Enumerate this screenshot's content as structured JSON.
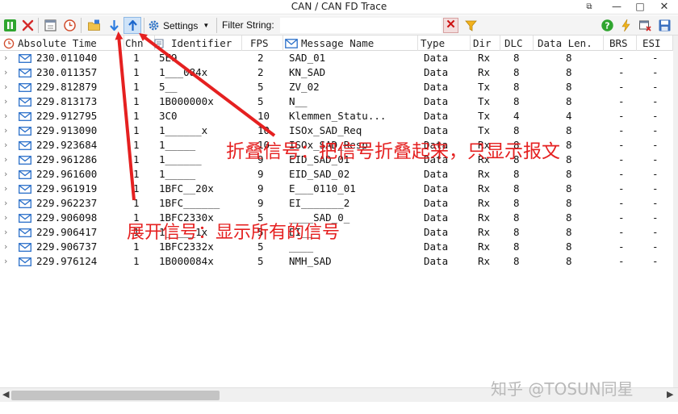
{
  "window": {
    "title": "CAN / CAN FD Trace",
    "controls": {
      "restore": "⧉",
      "minimize": "—",
      "maximize": "□",
      "close": "✕"
    }
  },
  "toolbar": {
    "settings_label": "Settings",
    "filter_label": "Filter String:",
    "filter_value": "",
    "filter_clear": "✕"
  },
  "columns": {
    "time": "Absolute Time",
    "chn": "Chn",
    "identifier": "Identifier",
    "fps": "FPS",
    "message": "Message Name",
    "type": "Type",
    "dir": "Dir",
    "dlc": "DLC",
    "data_len": "Data Len.",
    "brs": "BRS",
    "esi": "ESI"
  },
  "rows": [
    {
      "time": "230.011040",
      "chn": "1",
      "id": "5E9",
      "fps": "2",
      "msg": "SAD_01",
      "type": "Data",
      "dir": "Rx",
      "dlc": "8",
      "len": "8",
      "brs": "-",
      "esi": "-"
    },
    {
      "time": "230.011357",
      "chn": "1",
      "id": "1___084x",
      "fps": "2",
      "msg": "KN_SAD",
      "type": "Data",
      "dir": "Rx",
      "dlc": "8",
      "len": "8",
      "brs": "-",
      "esi": "-"
    },
    {
      "time": "229.812879",
      "chn": "1",
      "id": "5__",
      "fps": "5",
      "msg": "ZV_02",
      "type": "Data",
      "dir": "Tx",
      "dlc": "8",
      "len": "8",
      "brs": "-",
      "esi": "-"
    },
    {
      "time": "229.813173",
      "chn": "1",
      "id": "1B000000x",
      "fps": "5",
      "msg": "N__",
      "type": "Data",
      "dir": "Tx",
      "dlc": "8",
      "len": "8",
      "brs": "-",
      "esi": "-"
    },
    {
      "time": "229.912795",
      "chn": "1",
      "id": "3C0",
      "fps": "10",
      "msg": "Klemmen_Statu...",
      "type": "Data",
      "dir": "Tx",
      "dlc": "4",
      "len": "4",
      "brs": "-",
      "esi": "-"
    },
    {
      "time": "229.913090",
      "chn": "1",
      "id": "1______x",
      "fps": "10",
      "msg": "ISOx_SAD_Req",
      "type": "Data",
      "dir": "Tx",
      "dlc": "8",
      "len": "8",
      "brs": "-",
      "esi": "-"
    },
    {
      "time": "229.923684",
      "chn": "1",
      "id": "1_____",
      "fps": "10",
      "msg": "ISOx_SAD_Resp",
      "type": "Data",
      "dir": "Rx",
      "dlc": "8",
      "len": "8",
      "brs": "-",
      "esi": "-"
    },
    {
      "time": "229.961286",
      "chn": "1",
      "id": "1______",
      "fps": "9",
      "msg": "EID_SAD_01",
      "type": "Data",
      "dir": "Rx",
      "dlc": "8",
      "len": "8",
      "brs": "-",
      "esi": "-"
    },
    {
      "time": "229.961600",
      "chn": "1",
      "id": "1_____",
      "fps": "9",
      "msg": "EID_SAD_02",
      "type": "Data",
      "dir": "Rx",
      "dlc": "8",
      "len": "8",
      "brs": "-",
      "esi": "-"
    },
    {
      "time": "229.961919",
      "chn": "1",
      "id": "1BFC__20x",
      "fps": "9",
      "msg": "E___0110_01",
      "type": "Data",
      "dir": "Rx",
      "dlc": "8",
      "len": "8",
      "brs": "-",
      "esi": "-"
    },
    {
      "time": "229.962237",
      "chn": "1",
      "id": "1BFC______",
      "fps": "9",
      "msg": "EI_______2",
      "type": "Data",
      "dir": "Rx",
      "dlc": "8",
      "len": "8",
      "brs": "-",
      "esi": "-"
    },
    {
      "time": "229.906098",
      "chn": "1",
      "id": "1BFC2330x",
      "fps": "5",
      "msg": "____SAD_0_",
      "type": "Data",
      "dir": "Rx",
      "dlc": "8",
      "len": "8",
      "brs": "-",
      "esi": "-"
    },
    {
      "time": "229.906417",
      "chn": "1",
      "id": "1_____1x",
      "fps": "5",
      "msg": "EI___",
      "type": "Data",
      "dir": "Rx",
      "dlc": "8",
      "len": "8",
      "brs": "-",
      "esi": "-"
    },
    {
      "time": "229.906737",
      "chn": "1",
      "id": "1BFC2332x",
      "fps": "5",
      "msg": "____",
      "type": "Data",
      "dir": "Rx",
      "dlc": "8",
      "len": "8",
      "brs": "-",
      "esi": "-"
    },
    {
      "time": "229.976124",
      "chn": "1",
      "id": "1B000084x",
      "fps": "5",
      "msg": "NMH_SAD",
      "type": "Data",
      "dir": "Rx",
      "dlc": "8",
      "len": "8",
      "brs": "-",
      "esi": "-"
    }
  ],
  "annotations": {
    "collapse": "折叠信号：把信号折叠起来，只显示报文",
    "expand": "展开信号：显示所有的信号"
  },
  "watermark": "知乎 @TOSUN同星",
  "colors": {
    "annotation": "#e52020",
    "envelope": "#2a6fc9",
    "toolbar_bg": "#f4f4f4",
    "arrow_expand": "#2d7de0",
    "arrow_collapse": "#1a66cc"
  }
}
